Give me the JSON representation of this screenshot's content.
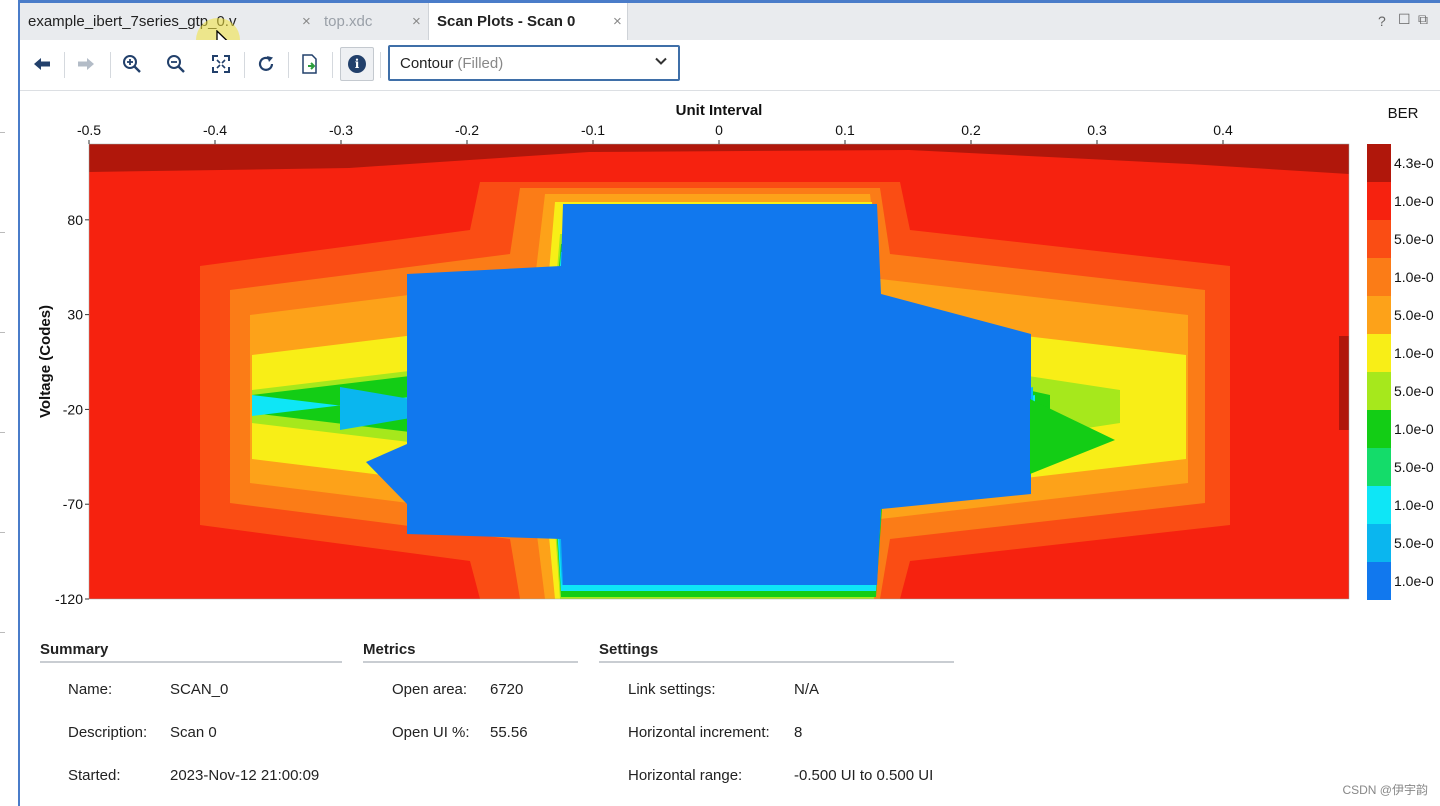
{
  "tabs": [
    {
      "label": "example_ibert_7series_gtp_0.v",
      "close": "×"
    },
    {
      "label": "top.xdc",
      "close": "×"
    },
    {
      "label": "Scan Plots - Scan 0",
      "close": "×"
    }
  ],
  "window_controls": {
    "help": "?",
    "restore": "☐",
    "float": "⧉"
  },
  "toolbar": {
    "icons": [
      "back-arrow-icon",
      "forward-arrow-icon",
      "zoom-in-icon",
      "zoom-out-icon",
      "zoom-fit-icon",
      "refresh-icon",
      "export-icon",
      "info-icon"
    ],
    "info_glyph": "i",
    "plot_type": {
      "value": "Contour",
      "qualifier": "(Filled)"
    }
  },
  "chart_data": {
    "type": "heatmap",
    "title": "",
    "xlabel": "Unit Interval",
    "ylabel": "Voltage (Codes)",
    "xlim": [
      -0.5,
      0.5
    ],
    "ylim": [
      -120,
      120
    ],
    "x_ticks": [
      "-0.5",
      "-0.4",
      "-0.3",
      "-0.2",
      "-0.1",
      "0",
      "0.1",
      "0.2",
      "0.3",
      "0.4"
    ],
    "y_ticks": [
      "80",
      "30",
      "-20",
      "-70",
      "-120"
    ],
    "legend_title": "BER",
    "legend_entries": [
      "4.3e-0",
      "1.0e-0",
      "5.0e-0",
      "1.0e-0",
      "5.0e-0",
      "1.0e-0",
      "5.0e-0",
      "1.0e-0",
      "5.0e-0",
      "1.0e-0",
      "5.0e-0",
      "1.0e-0"
    ],
    "legend_colors": [
      "#b0170b",
      "#f6220f",
      "#fa4d14",
      "#fb7c17",
      "#fda219",
      "#f8ee17",
      "#a6e81c",
      "#13cd15",
      "#14dc6a",
      "#0ee6f6",
      "#0ab6ef",
      "#1178ee"
    ],
    "open_area": 6720,
    "open_ui_percent": 55.56
  },
  "summary": {
    "title": "Summary",
    "rows": [
      {
        "label": "Name:",
        "value": "SCAN_0"
      },
      {
        "label": "Description:",
        "value": "Scan 0"
      },
      {
        "label": "Started:",
        "value": "2023-Nov-12 21:00:09"
      }
    ]
  },
  "metrics": {
    "title": "Metrics",
    "rows": [
      {
        "label": "Open area:",
        "value": "6720"
      },
      {
        "label": "Open UI %:",
        "value": "55.56"
      }
    ]
  },
  "settings": {
    "title": "Settings",
    "rows": [
      {
        "label": "Link settings:",
        "value": "N/A"
      },
      {
        "label": "Horizontal increment:",
        "value": "8"
      },
      {
        "label": "Horizontal range:",
        "value": "-0.500 UI to 0.500 UI"
      }
    ]
  },
  "watermark": "CSDN @伊宇韵"
}
